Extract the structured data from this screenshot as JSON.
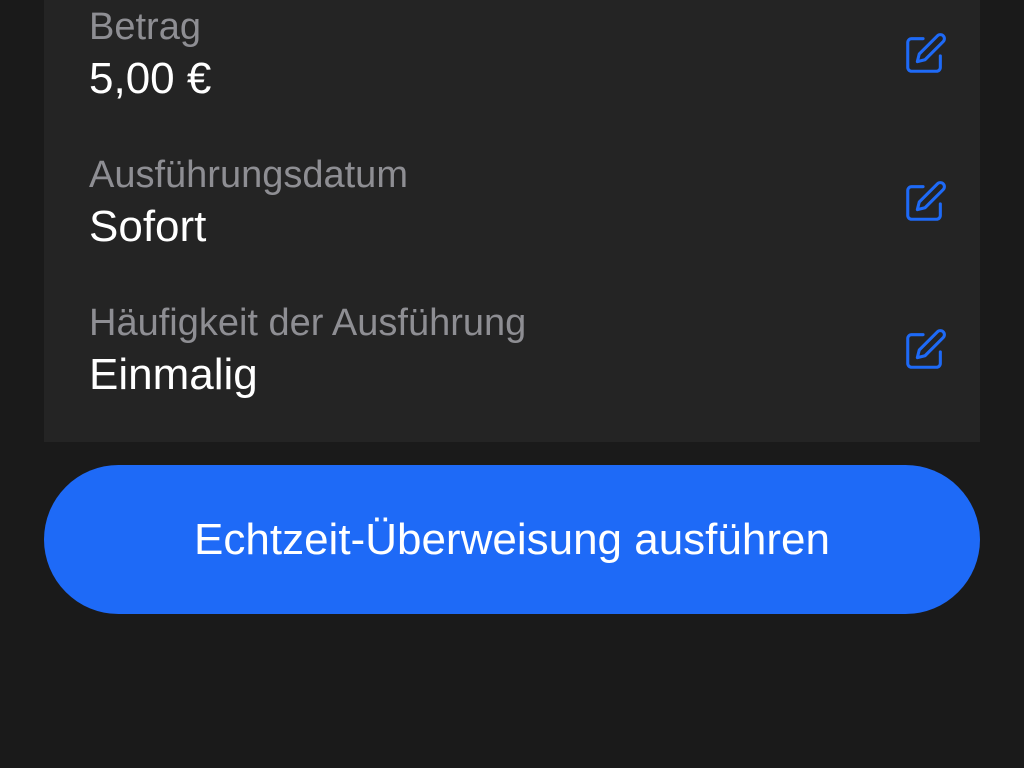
{
  "details": {
    "rows": [
      {
        "label": "Betrag",
        "value": "5,00 €",
        "action_icon": "edit-icon"
      },
      {
        "label": "Ausführungsdatum",
        "value": "Sofort",
        "action_icon": "edit-icon"
      },
      {
        "label": "Häufigkeit der Ausführung",
        "value": "Einmalig",
        "action_icon": "edit-icon"
      }
    ]
  },
  "submit": {
    "label": "Echtzeit-Überweisung ausführen"
  },
  "colors": {
    "background": "#1a1a1a",
    "card": "#242424",
    "label": "#8e8e93",
    "value": "#ffffff",
    "accent": "#1e6af7"
  }
}
